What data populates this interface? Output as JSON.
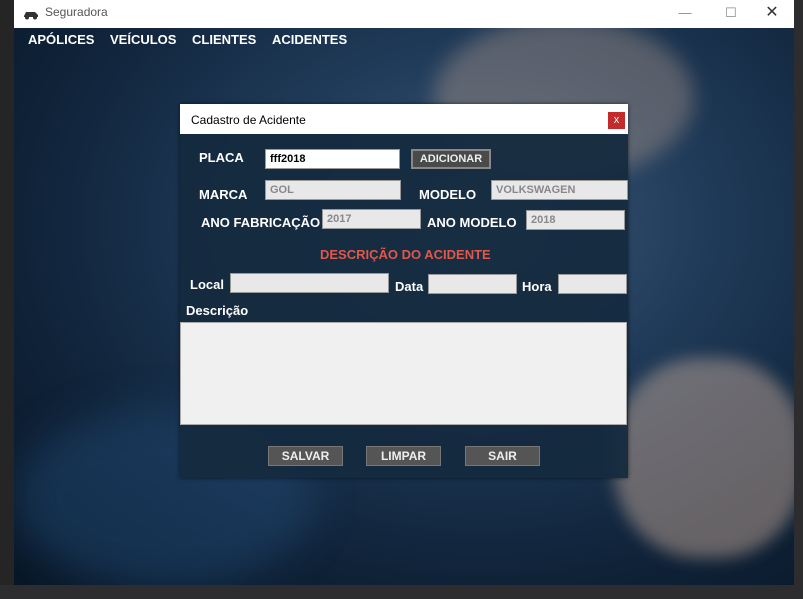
{
  "window": {
    "title": "Seguradora",
    "minimize_glyph": "—",
    "maximize_glyph": "☐",
    "close_glyph": "✕"
  },
  "menu": {
    "items": [
      "APÓLICES",
      "VEÍCULOS",
      "CLIENTES",
      "ACIDENTES"
    ]
  },
  "dialog": {
    "title": "Cadastro de Acidente",
    "close_label": "x",
    "placa_label": "PLACA",
    "placa_value": "fff2018",
    "adicionar_label": "ADICIONAR",
    "marca_label": "MARCA",
    "marca_value": "GOL",
    "modelo_label": "MODELO",
    "modelo_value": "VOLKSWAGEN",
    "ano_fabricacao_label": "ANO FABRICAÇÃO",
    "ano_fabricacao_value": "2017",
    "ano_modelo_label": "ANO MODELO",
    "ano_modelo_value": "2018",
    "section_title": "DESCRIÇÃO DO ACIDENTE",
    "local_label": "Local",
    "local_value": "",
    "data_label": "Data",
    "data_value": "",
    "hora_label": "Hora",
    "hora_value": "",
    "descricao_label": "Descrição",
    "descricao_value": "",
    "salvar_label": "SALVAR",
    "limpar_label": "LIMPAR",
    "sair_label": "SAIR"
  },
  "colors": {
    "section_title": "#e0574b",
    "dialog_close": "#c42b2b"
  }
}
